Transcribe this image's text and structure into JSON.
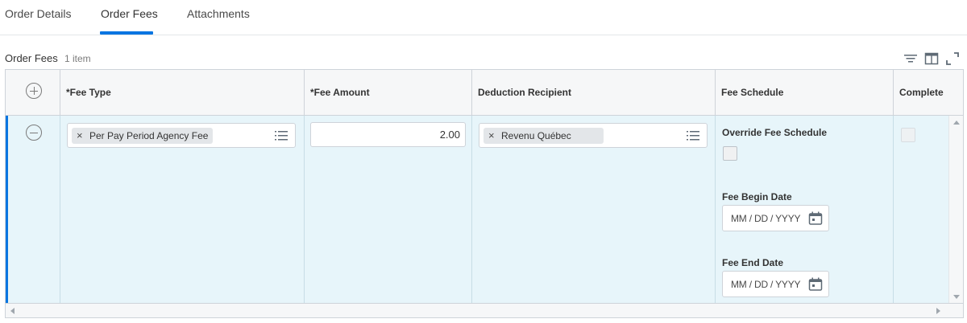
{
  "tabs": [
    {
      "label": "Order Details"
    },
    {
      "label": "Order Fees"
    },
    {
      "label": "Attachments"
    }
  ],
  "active_tab": "Order Fees",
  "section": {
    "title": "Order Fees",
    "count": "1 item"
  },
  "toolbar_icons": [
    "filter-icon",
    "columns-icon",
    "expand-icon"
  ],
  "grid": {
    "columns": [
      "*Fee Type",
      "*Fee Amount",
      "Deduction Recipient",
      "Fee Schedule",
      "Complete"
    ],
    "row": {
      "fee_type": "Per Pay Period Agency Fee",
      "fee_amount": "2.00",
      "deduction_recipient": "Revenu Québec",
      "fee_schedule": {
        "override_label": "Override Fee Schedule",
        "override_checked": false,
        "begin_label": "Fee Begin Date",
        "begin_placeholder": "MM / DD / YYYY",
        "end_label": "Fee End Date",
        "end_placeholder": "MM / DD / YYYY"
      },
      "complete_checked": false
    }
  },
  "colors": {
    "accent": "#0875e1",
    "row_highlight": "#e7f5fa",
    "border": "#ced3d9"
  }
}
